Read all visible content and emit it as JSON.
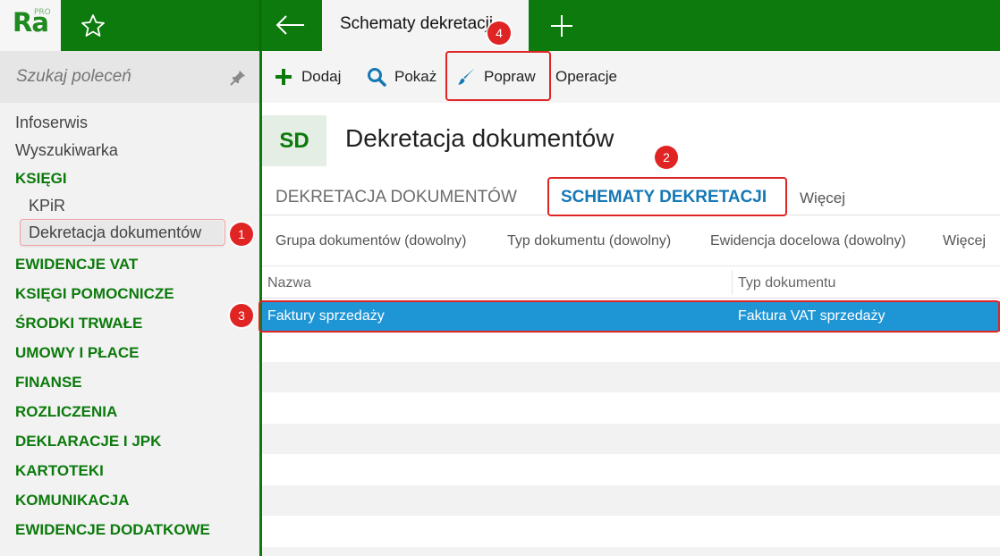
{
  "app": {
    "logo": "Ra",
    "logo_edition": "PRO",
    "active_tab": "Schematy dekretacji"
  },
  "sidebar": {
    "search_placeholder": "Szukaj poleceń",
    "items": [
      {
        "label": "Infoserwis",
        "kind": "plain"
      },
      {
        "label": "Wyszukiwarka",
        "kind": "plain"
      },
      {
        "label": "KSIĘGI",
        "kind": "section"
      },
      {
        "label": "KPiR",
        "kind": "sub"
      },
      {
        "label": "Dekretacja dokumentów",
        "kind": "sub",
        "selected": true
      },
      {
        "label": "EWIDENCJE VAT",
        "kind": "section"
      },
      {
        "label": "KSIĘGI POMOCNICZE",
        "kind": "section"
      },
      {
        "label": "ŚRODKI TRWAŁE",
        "kind": "section"
      },
      {
        "label": "UMOWY I PŁACE",
        "kind": "section"
      },
      {
        "label": "FINANSE",
        "kind": "section"
      },
      {
        "label": "ROZLICZENIA",
        "kind": "section"
      },
      {
        "label": "DEKLARACJE I JPK",
        "kind": "section"
      },
      {
        "label": "KARTOTEKI",
        "kind": "section"
      },
      {
        "label": "KOMUNIKACJA",
        "kind": "section"
      },
      {
        "label": "EWIDENCJE DODATKOWE",
        "kind": "section"
      }
    ]
  },
  "toolbar": {
    "add_label": "Dodaj",
    "show_label": "Pokaż",
    "edit_label": "Popraw",
    "operations_label": "Operacje"
  },
  "header": {
    "badge": "SD",
    "title": "Dekretacja dokumentów"
  },
  "tabs": [
    {
      "label": "DEKRETACJA DOKUMENTÓW",
      "selected": false
    },
    {
      "label": "SCHEMATY DEKRETACJI",
      "selected": true
    }
  ],
  "tabs_more": "Więcej",
  "filters": [
    "Grupa dokumentów (dowolny)",
    "Typ dokumentu (dowolny)",
    "Ewidencja docelowa (dowolny)",
    "Więcej"
  ],
  "grid": {
    "columns": [
      "Nazwa",
      "Typ dokumentu"
    ],
    "rows": [
      {
        "name": "Faktury sprzedaży",
        "type": "Faktura VAT sprzedaży",
        "selected": true
      }
    ]
  },
  "annotations": [
    "1",
    "2",
    "3",
    "4"
  ],
  "colors": {
    "brand_green": "#0c7a0c",
    "selected_tab_blue": "#1478b4",
    "selected_row_blue": "#1e96d6",
    "callout_red": "#e02424"
  }
}
